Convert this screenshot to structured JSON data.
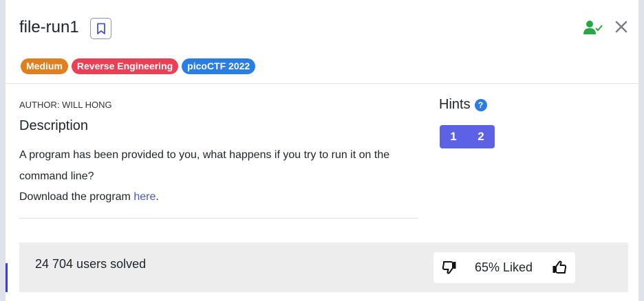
{
  "challenge": {
    "title": "file-run1",
    "tags": [
      {
        "label": "Medium",
        "color": "#e07f1f"
      },
      {
        "label": "Reverse Engineering",
        "color": "#eb3f55"
      },
      {
        "label": "picoCTF 2022",
        "color": "#2a7de3"
      }
    ],
    "author": "AUTHOR: WILL HONG",
    "description_heading": "Description",
    "description_line1": "A program has been provided to you, what happens if you try to run it on the command line?",
    "description_line2_prefix": "Download the program ",
    "description_link": "here",
    "description_line2_suffix": "."
  },
  "hints": {
    "heading": "Hints",
    "help_glyph": "?",
    "buttons": [
      "1",
      "2"
    ]
  },
  "stats": {
    "solved": "24 704 users solved",
    "liked": "65% Liked"
  },
  "icons": {
    "bookmark": "bookmark-icon",
    "user_check": "user-check-icon",
    "close": "close-icon",
    "thumb_down": "thumbs-down-icon",
    "thumb_up": "thumbs-up-icon"
  }
}
